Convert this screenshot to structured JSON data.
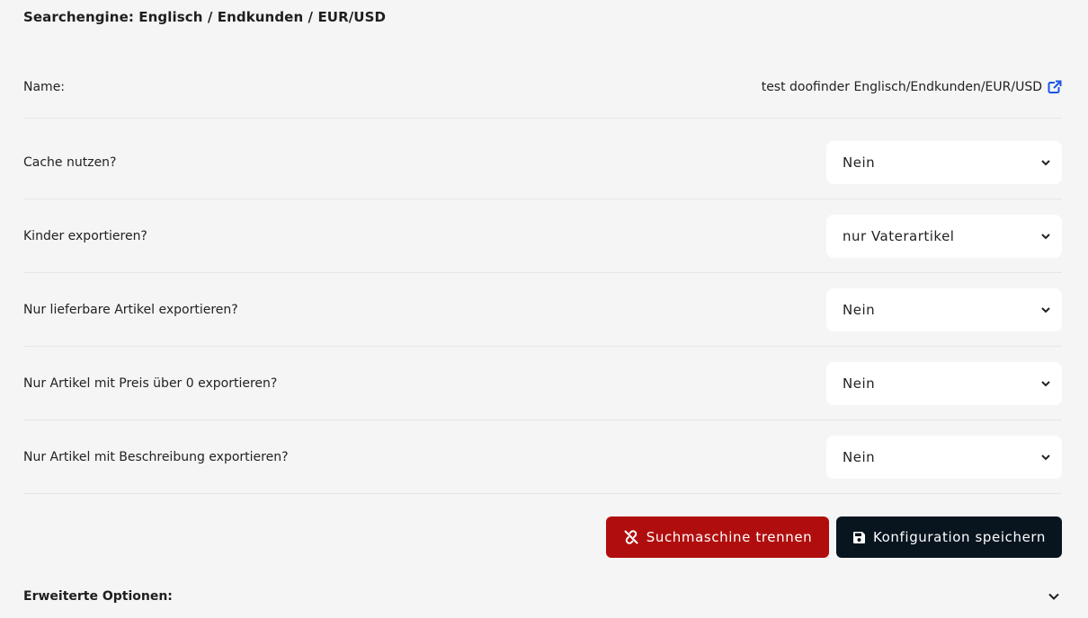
{
  "page": {
    "title": "Searchengine: Englisch / Endkunden / EUR/USD"
  },
  "name_row": {
    "label": "Name:",
    "value": "test doofinder Englisch/Endkunden/EUR/USD",
    "icon": "external-link-icon",
    "accent": "#1a56e8"
  },
  "settings": [
    {
      "label": "Cache nutzen?",
      "selected": "Nein"
    },
    {
      "label": "Kinder exportieren?",
      "selected": "nur Vaterartikel"
    },
    {
      "label": "Nur lieferbare Artikel exportieren?",
      "selected": "Nein"
    },
    {
      "label": "Nur Artikel mit Preis über 0 exportieren?",
      "selected": "Nein"
    },
    {
      "label": "Nur Artikel mit Beschreibung exportieren?",
      "selected": "Nein"
    }
  ],
  "actions": {
    "disconnect_label": "Suchmaschine trennen",
    "disconnect_icon": "unlink-icon",
    "disconnect_color": "#b00e0e",
    "save_label": "Konfiguration speichern",
    "save_icon": "floppy-disk-icon",
    "save_color": "#08141e"
  },
  "advanced": {
    "label": "Erweiterte Optionen:",
    "icon": "chevron-down-icon"
  }
}
